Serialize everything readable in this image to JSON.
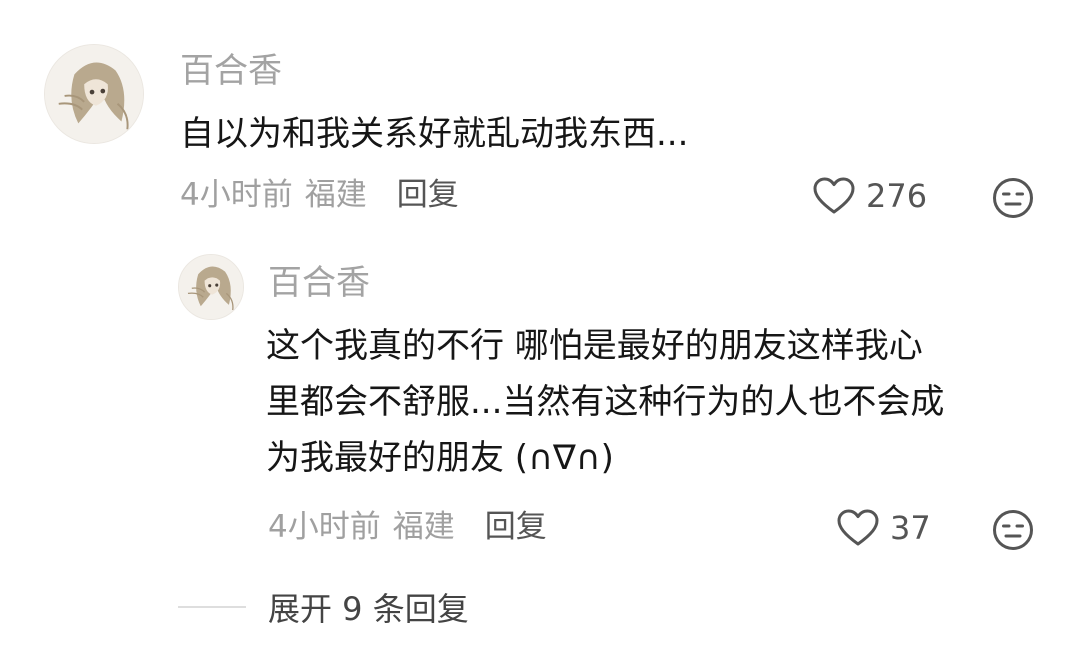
{
  "comments": [
    {
      "username": "百合香",
      "text_lines": [
        "自以为和我关系好就乱动我东西..."
      ],
      "time": "4小时前",
      "location": "福建",
      "reply_label": "回复",
      "likes": "276"
    },
    {
      "username": "百合香",
      "text_lines": [
        "这个我真的不行 哪怕是最好的朋友这样我心",
        "里都会不舒服...当然有这种行为的人也不会成",
        "为我最好的朋友 (∩∇∩)"
      ],
      "time": "4小时前",
      "location": "福建",
      "reply_label": "回复",
      "likes": "37"
    }
  ],
  "expand_replies": "展开 9 条回复",
  "icons": {
    "like": "heart-outline-icon",
    "reaction": "neutral-face-icon"
  },
  "colors": {
    "username": "#a3a3a3",
    "meta": "#a0a0a0",
    "text": "#161616"
  }
}
